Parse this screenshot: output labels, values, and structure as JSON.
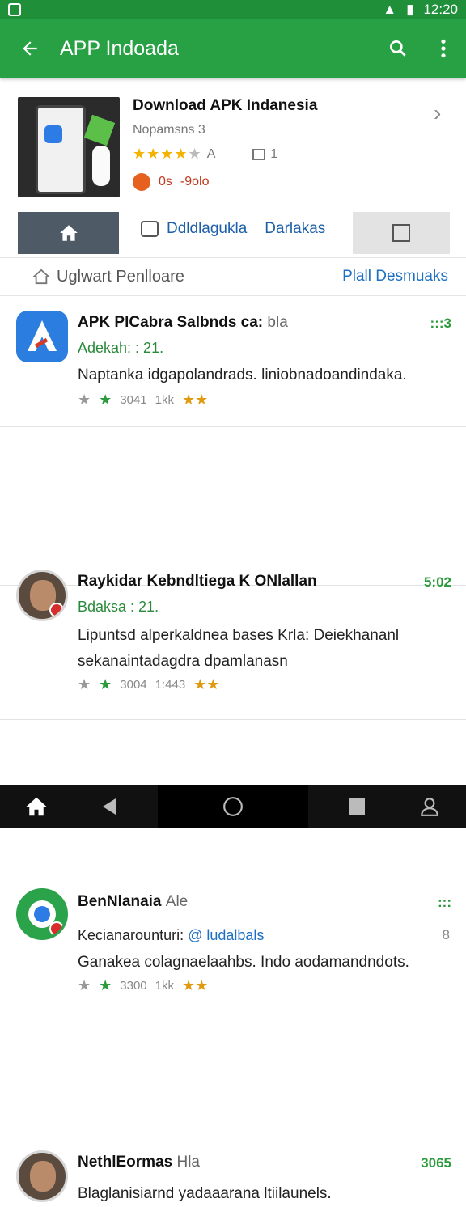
{
  "status": {
    "time": "12:20"
  },
  "appbar": {
    "title": "APP Indoada"
  },
  "header": {
    "title": "Download APK Indanesia",
    "subtitle": "Nopamsns 3",
    "rating_text": "A",
    "count_text": "1",
    "badge_left": "0s",
    "badge_right": "-9olo"
  },
  "tabs": {
    "mid_label": "Ddldlagukla",
    "mid_label2": "Darlakas"
  },
  "subrow": {
    "left": "Uglwart Penlloare",
    "right": "Plall Desmuaks"
  },
  "items": [
    {
      "name": "APK PlCabra Salbnds ca:",
      "name_suffix": "bla",
      "meta": "Adekah: : 21.",
      "body": "Naptanka idgapolandrads. liniobnadoandindaka.",
      "stats": "3041",
      "views": "1kk",
      "count": ":::3"
    },
    {
      "name": "Raykidar Kebndltiega K ONlallan",
      "meta": "Bdaksa : 21.",
      "body": "Lipuntsd alperkaldnea bases Krla: Deiekhananl sekanaintadagdra dpamlanasn",
      "stats": "3004",
      "views": "1:443",
      "count": "5:02"
    },
    {
      "name": "BenNlanaia",
      "name_suffix": "Ale",
      "meta_label": "Kecianarounturi: ",
      "meta_handle": "@ ludalbals",
      "side": "8",
      "body": "Ganakea colagnaelaahbs. Indo aodamandndots.",
      "stats": "3300",
      "views": "1kk",
      "count": ":::"
    },
    {
      "name": "NethlEormas",
      "name_suffix": "Hla",
      "body": "Blaglanisiarnd yadaaarana ltiilaunels.",
      "count": "3065"
    }
  ],
  "icons": {
    "back": "arrow-left-icon",
    "search": "search-icon",
    "more": "more-vert-icon",
    "home": "home-icon",
    "back_nav": "back-triangle-icon",
    "recents": "recents-square-icon",
    "profile": "profile-icon"
  },
  "colors": {
    "appbar": "#27a144",
    "statusbar": "#1f8f3a",
    "link": "#1d6fc4",
    "accent_green": "#2a9a3b"
  }
}
